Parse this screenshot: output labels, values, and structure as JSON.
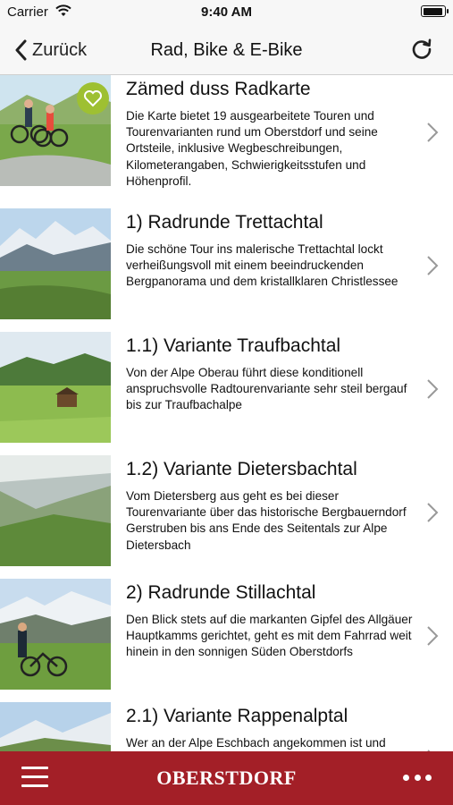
{
  "status_bar": {
    "carrier": "Carrier",
    "time": "9:40 AM"
  },
  "nav": {
    "back_label": "Zurück",
    "title": "Rad, Bike & E-Bike"
  },
  "items": [
    {
      "title": "Zämed duss Radkarte",
      "desc": "Die Karte bietet 19 ausgearbeitete Touren und Tourenvarianten rund um Oberstdorf und seine Ortsteile, inklusive Wegbeschreibungen, Kilometerangaben, Schwierigkeitsstufen und Höhenprofil."
    },
    {
      "title": "1) Radrunde Trettachtal",
      "desc": "Die schöne Tour ins malerische Trettachtal lockt verheißungsvoll mit einem beeindruckenden Bergpanorama und dem kristallklaren Christlessee"
    },
    {
      "title": "1.1) Variante Traufbachtal",
      "desc": "Von der Alpe Oberau führt diese konditionell anspruchsvolle Radtourenvariante sehr steil bergauf bis zur Traufbachalpe"
    },
    {
      "title": "1.2) Variante Dietersbachtal",
      "desc": "Vom Dietersberg aus geht es bei dieser Tourenvariante über das historische Bergbauerndorf Gerstruben bis ans Ende des Seitentals zur Alpe Dietersbach"
    },
    {
      "title": "2) Radrunde Stillachtal",
      "desc": "Den Blick stets auf die markanten Gipfel des Allgäuer Hauptkamms gerichtet, geht es mit dem Fahrrad weit hinein in den sonnigen Süden Oberstdorfs"
    },
    {
      "title": "2.1) Variante Rappenalptal",
      "desc": "Wer an der Alpe Eschbach angekommen ist und"
    }
  ],
  "bottom_bar": {
    "brand": "OBERSTDORF"
  },
  "colors": {
    "brand_red": "#a31f27",
    "heart_badge": "#9ec032"
  },
  "icons": [
    "wifi-icon",
    "battery-icon",
    "back-chevron-icon",
    "refresh-icon",
    "heart-icon",
    "chevron-right-icon",
    "hamburger-menu-icon",
    "more-dots-icon"
  ]
}
